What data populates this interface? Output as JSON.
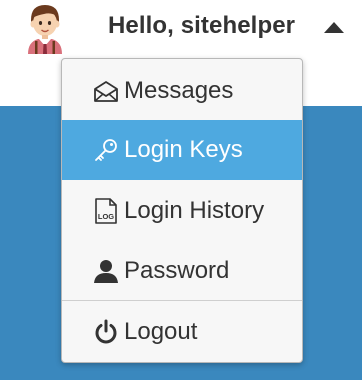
{
  "header": {
    "greeting": "Hello, sitehelper",
    "avatar_icon": "user-avatar-icon",
    "caret_icon": "caret-up-icon"
  },
  "menu": {
    "items": [
      {
        "label": "Messages",
        "icon": "envelope-icon",
        "active": false
      },
      {
        "label": "Login Keys",
        "icon": "key-icon",
        "active": true
      },
      {
        "label": "Login History",
        "icon": "log-file-icon",
        "active": false
      },
      {
        "label": "Password",
        "icon": "user-icon",
        "active": false
      },
      {
        "label": "Logout",
        "icon": "power-icon",
        "active": false
      }
    ]
  },
  "colors": {
    "background_blue": "#3a88be",
    "active_item": "#4ea9e0",
    "menu_background": "#f7f7f7",
    "text": "#333333"
  }
}
